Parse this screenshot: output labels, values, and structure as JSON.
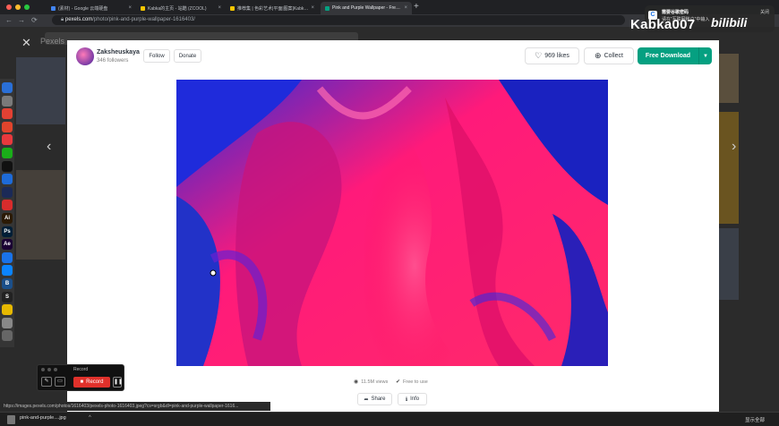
{
  "browser": {
    "tabs": [
      {
        "label": "(素材) - Google 云端硬盘",
        "fav": "#4285f4",
        "active": false
      },
      {
        "label": "Kabka的主页 - 站酷 (ZCOOL)",
        "fav": "#f7c600",
        "active": false
      },
      {
        "label": "推荐集 | 色彩艺术|平面|图案|Kabka...",
        "fav": "#f7c600",
        "active": false
      },
      {
        "label": "Pink and Purple Wallpaper - Free...",
        "fav": "#05a081",
        "active": true
      }
    ],
    "new_tab": "+",
    "url_domain": "pexels.com",
    "url_path": "/photo/pink-and-purple-wallpaper-1616403/",
    "nav": {
      "back": "←",
      "forward": "→",
      "reload": "⟳"
    }
  },
  "background_page": {
    "logo": "Pexels",
    "close_glyph": "✕",
    "prev_glyph": "‹",
    "next_glyph": "›"
  },
  "modal": {
    "author_name": "Zaksheuskaya",
    "followers": "346 followers",
    "follow_label": "Follow",
    "donate_label": "Donate",
    "likes_label": "969 likes",
    "heart_glyph": "♡",
    "collect_label": "Collect",
    "collect_glyph": "⊕",
    "download_label": "Free Download",
    "download_chevron": "▼",
    "views_label": "11.5M views",
    "eye_glyph": "◉",
    "free_label": "Free to use",
    "check_glyph": "✔",
    "share_label": "Share",
    "share_glyph": "➦",
    "info_label": "Info",
    "info_glyph": "ℹ"
  },
  "recorder": {
    "title": "Record",
    "record_label": "Record",
    "pen_glyph": "✎",
    "screen_glyph": "▭",
    "pause_glyph": "❚❚"
  },
  "status_url": "https://images.pexels.com/photos/1616403/pexels-photo-1616403.jpeg?cs=srgb&dl=pink-and-purple-wallpaper-1616...",
  "download_shelf": {
    "file": "pink-and-purple....jpg",
    "chevron": "^",
    "show_all": "显示全部"
  },
  "dock": [
    {
      "label": "",
      "color": "#2a6fd6",
      "icon": "finder-icon"
    },
    {
      "label": "",
      "color": "#7a7a7a",
      "icon": "launchpad-icon"
    },
    {
      "label": "",
      "color": "#e34133",
      "icon": "chrome-icon"
    },
    {
      "label": "",
      "color": "#e0442c",
      "icon": "app-icon"
    },
    {
      "label": "",
      "color": "#e8393d",
      "icon": "weibo-icon"
    },
    {
      "label": "",
      "color": "#1aad19",
      "icon": "wechat-icon"
    },
    {
      "label": "",
      "color": "#111111",
      "icon": "qq-icon"
    },
    {
      "label": "",
      "color": "#1e6bd8",
      "icon": "app-icon"
    },
    {
      "label": "",
      "color": "#1b2a57",
      "icon": "app-icon"
    },
    {
      "label": "",
      "color": "#d82c2c",
      "icon": "app-icon"
    },
    {
      "label": "Ai",
      "color": "#2b1a05",
      "icon": "illustrator-icon"
    },
    {
      "label": "Ps",
      "color": "#001e36",
      "icon": "photoshop-icon"
    },
    {
      "label": "Ae",
      "color": "#1a0033",
      "icon": "after-effects-icon"
    },
    {
      "label": "",
      "color": "#1a73e8",
      "icon": "app-icon"
    },
    {
      "label": "",
      "color": "#0b84ff",
      "icon": "app-store-icon"
    },
    {
      "label": "B",
      "color": "#1b4f8a",
      "icon": "app-icon"
    },
    {
      "label": "S",
      "color": "#222222",
      "icon": "app-icon"
    },
    {
      "label": "",
      "color": "#e6b800",
      "icon": "app-icon"
    },
    {
      "label": "",
      "color": "#888888",
      "icon": "folder-icon"
    },
    {
      "label": "",
      "color": "#666666",
      "icon": "trash-icon"
    }
  ],
  "watermark": {
    "user": "Kabka007",
    "site": "bilibili"
  },
  "notification": {
    "app_glyph": "C",
    "title": "需要谷歌密码",
    "body": "请在“互联网账户”中输入",
    "close": "关闭"
  }
}
